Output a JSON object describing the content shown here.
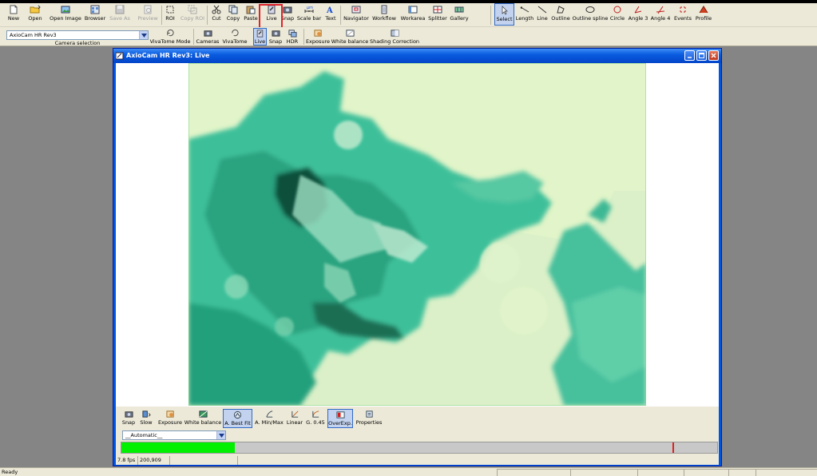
{
  "toolbar1": [
    {
      "label": "New",
      "icon": "new-document-icon"
    },
    {
      "label": "Open",
      "icon": "open-folder-icon"
    },
    {
      "label": "Open Image",
      "icon": "open-image-icon"
    },
    {
      "label": "Browser",
      "icon": "browser-icon"
    },
    {
      "label": "Save As",
      "icon": "save-as-icon",
      "disabled": true
    },
    {
      "label": "Preview",
      "icon": "preview-icon",
      "disabled": true
    },
    {
      "label": "ROI",
      "icon": "roi-icon"
    },
    {
      "label": "Copy ROI",
      "icon": "copy-roi-icon",
      "disabled": true
    },
    {
      "label": "Cut",
      "icon": "cut-icon"
    },
    {
      "label": "Copy",
      "icon": "copy-icon"
    },
    {
      "label": "Paste",
      "icon": "paste-icon"
    },
    {
      "label": "Live",
      "icon": "live-camera-icon"
    },
    {
      "label": "Snap",
      "icon": "snap-camera-icon"
    },
    {
      "label": "Scale bar",
      "icon": "scale-bar-icon"
    },
    {
      "label": "Text",
      "icon": "text-icon"
    },
    {
      "label": "Navigator",
      "icon": "navigator-icon"
    },
    {
      "label": "Workflow",
      "icon": "workflow-icon"
    },
    {
      "label": "Workarea",
      "icon": "workarea-icon"
    },
    {
      "label": "Splitter",
      "icon": "splitter-icon"
    },
    {
      "label": "Gallery",
      "icon": "gallery-icon"
    },
    {
      "label": "Select",
      "icon": "select-arrow-icon",
      "pressed": true
    },
    {
      "label": "Length",
      "icon": "length-icon"
    },
    {
      "label": "Line",
      "icon": "line-icon"
    },
    {
      "label": "Outline",
      "icon": "outline-icon"
    },
    {
      "label": "Outline spline",
      "icon": "outline-spline-icon"
    },
    {
      "label": "Circle",
      "icon": "circle-icon"
    },
    {
      "label": "Angle 3",
      "icon": "angle-3-icon"
    },
    {
      "label": "Angle 4",
      "icon": "angle-4-icon"
    },
    {
      "label": "Events",
      "icon": "events-icon"
    },
    {
      "label": "Profile",
      "icon": "profile-icon"
    }
  ],
  "camera_selection": {
    "value": "AxioCam HR Rev3",
    "caption": "Camera selection"
  },
  "toolbar2": [
    {
      "label": "VivaTome Mode",
      "icon": "vivatome-mode-icon"
    },
    {
      "label": "Cameras",
      "icon": "cameras-icon"
    },
    {
      "label": "VivaTome",
      "icon": "vivatome-icon"
    },
    {
      "label": "Live",
      "icon": "live-camera-icon",
      "pressed": true
    },
    {
      "label": "Snap",
      "icon": "snap-camera-icon"
    },
    {
      "label": "HDR",
      "icon": "hdr-icon"
    },
    {
      "label": "Exposure",
      "icon": "exposure-icon"
    },
    {
      "label": "White balance",
      "icon": "white-balance-icon"
    },
    {
      "label": "Shading Correction",
      "icon": "shading-correction-icon"
    }
  ],
  "live_window": {
    "title": "AxioCam HR Rev3: Live",
    "controls": [
      {
        "label": "Snap",
        "icon": "snap-camera-icon"
      },
      {
        "label": "Slow",
        "icon": "slow-icon"
      },
      {
        "label": "Exposure",
        "icon": "exposure-icon"
      },
      {
        "label": "White balance",
        "icon": "white-balance-icon"
      },
      {
        "label": "A. Best Fit",
        "icon": "best-fit-icon",
        "pressed": true
      },
      {
        "label": "A. Min/Max",
        "icon": "min-max-icon"
      },
      {
        "label": "Linear",
        "icon": "linear-icon"
      },
      {
        "label": "G. 0.45",
        "icon": "gamma-icon"
      },
      {
        "label": "OverExp.",
        "icon": "overexposure-icon",
        "pressed": true
      },
      {
        "label": "Properties",
        "icon": "properties-icon"
      }
    ],
    "mode_select": "__Automatic__",
    "histogram": {
      "fill_fraction": 0.19,
      "marker_fraction": 0.925
    },
    "status": {
      "fps": "7.8 fps",
      "coords": "200,909"
    }
  },
  "colors": {
    "accent": "#0054e3",
    "highlight": "#e0232b",
    "histogram_fill": "#00f000"
  },
  "statusbar": {
    "text": "Ready"
  }
}
